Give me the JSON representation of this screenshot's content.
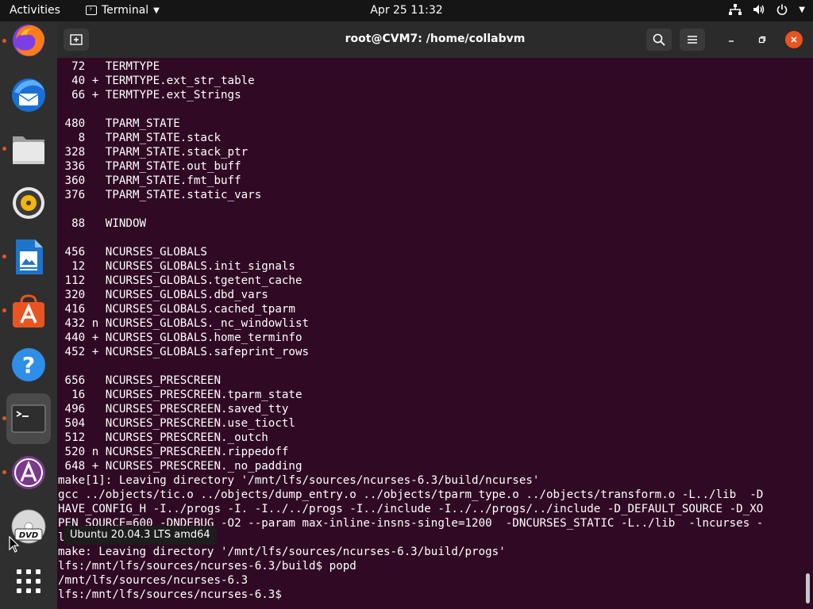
{
  "topbar": {
    "activities": "Activities",
    "app_name": "Terminal",
    "clock": "Apr 25  11:32"
  },
  "window": {
    "title": "root@CVM7: /home/collabvm"
  },
  "terminal": {
    "lines": [
      "  72   TERMTYPE",
      "  40 + TERMTYPE.ext_str_table",
      "  66 + TERMTYPE.ext_Strings",
      "",
      " 480   TPARM_STATE",
      "   8   TPARM_STATE.stack",
      " 328   TPARM_STATE.stack_ptr",
      " 336   TPARM_STATE.out_buff",
      " 360   TPARM_STATE.fmt_buff",
      " 376   TPARM_STATE.static_vars",
      "",
      "  88   WINDOW",
      "",
      " 456   NCURSES_GLOBALS",
      "  12   NCURSES_GLOBALS.init_signals",
      " 112   NCURSES_GLOBALS.tgetent_cache",
      " 320   NCURSES_GLOBALS.dbd_vars",
      " 416   NCURSES_GLOBALS.cached_tparm",
      " 432 n NCURSES_GLOBALS._nc_windowlist",
      " 440 + NCURSES_GLOBALS.home_terminfo",
      " 452 + NCURSES_GLOBALS.safeprint_rows",
      "",
      " 656   NCURSES_PRESCREEN",
      "  16   NCURSES_PRESCREEN.tparm_state",
      " 496   NCURSES_PRESCREEN.saved_tty",
      " 504   NCURSES_PRESCREEN.use_tioctl",
      " 512   NCURSES_PRESCREEN._outch",
      " 520 n NCURSES_PRESCREEN.rippedoff",
      " 648 + NCURSES_PRESCREEN._no_padding",
      "make[1]: Leaving directory '/mnt/lfs/sources/ncurses-6.3/build/ncurses'",
      "gcc ../objects/tic.o ../objects/dump_entry.o ../objects/tparm_type.o ../objects/transform.o -L../lib  -D",
      "HAVE_CONFIG_H -I../progs -I. -I../../progs -I../include -I../../progs/../include -D_DEFAULT_SOURCE -D_XO",
      "PEN_SOURCE=600 -DNDEBUG -O2 --param max-inline-insns-single=1200  -DNCURSES_STATIC -L../lib  -lncurses -",
      "l",
      "make: Leaving directory '/mnt/lfs/sources/ncurses-6.3/build/progs'",
      "lfs:/mnt/lfs/sources/ncurses-6.3/build$ popd",
      "/mnt/lfs/sources/ncurses-6.3",
      "lfs:/mnt/lfs/sources/ncurses-6.3$ "
    ]
  },
  "dock": {
    "items": [
      {
        "name": "firefox",
        "running": true
      },
      {
        "name": "thunderbird",
        "running": false
      },
      {
        "name": "files",
        "running": true
      },
      {
        "name": "rhythmbox",
        "running": false
      },
      {
        "name": "libreoffice-writer",
        "running": true
      },
      {
        "name": "ubuntu-software",
        "running": true
      },
      {
        "name": "help",
        "running": false
      },
      {
        "name": "terminal",
        "running": true
      },
      {
        "name": "app-installer",
        "running": true
      },
      {
        "name": "dvd",
        "running": false
      },
      {
        "name": "show-applications",
        "running": false
      }
    ]
  },
  "tooltip": {
    "text": "Ubuntu 20.04.3 LTS amd64"
  },
  "colors": {
    "terminal_bg": "#300a24",
    "accent": "#e95420",
    "close_button": "#e95420"
  }
}
